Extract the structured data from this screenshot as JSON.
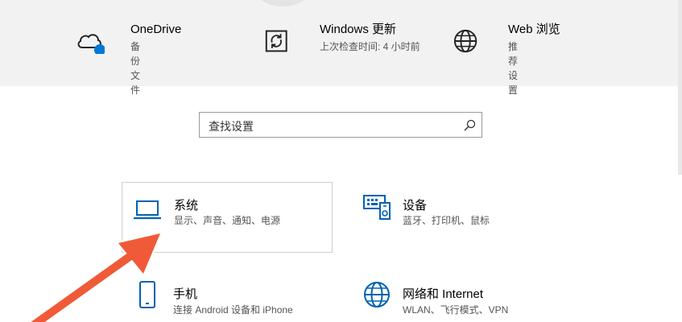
{
  "status_bar": {
    "onedrive": {
      "title": "OneDrive",
      "subtitle": "备份文件",
      "icon": "cloud-icon"
    },
    "windows_update": {
      "title": "Windows 更新",
      "subtitle": "上次检查时间: 4 小时前",
      "icon": "update-sync-icon"
    },
    "web_browse": {
      "title": "Web 浏览",
      "subtitle": "推荐设置",
      "icon": "globe-icon"
    }
  },
  "search": {
    "placeholder": "查找设置",
    "icon": "search-icon"
  },
  "categories": [
    {
      "title": "系统",
      "subtitle": "显示、声音、通知、电源",
      "icon": "laptop-icon"
    },
    {
      "title": "设备",
      "subtitle": "蓝牙、打印机、鼠标",
      "icon": "devices-icon"
    },
    {
      "title": "手机",
      "subtitle": "连接 Android 设备和 iPhone",
      "icon": "phone-icon"
    },
    {
      "title": "网络和 Internet",
      "subtitle": "WLAN、飞行模式、VPN",
      "icon": "network-globe-icon"
    }
  ],
  "colors": {
    "accent": "#0063b1",
    "onedrive_badge": "#0078d7",
    "annotation_arrow": "#f05a38"
  }
}
